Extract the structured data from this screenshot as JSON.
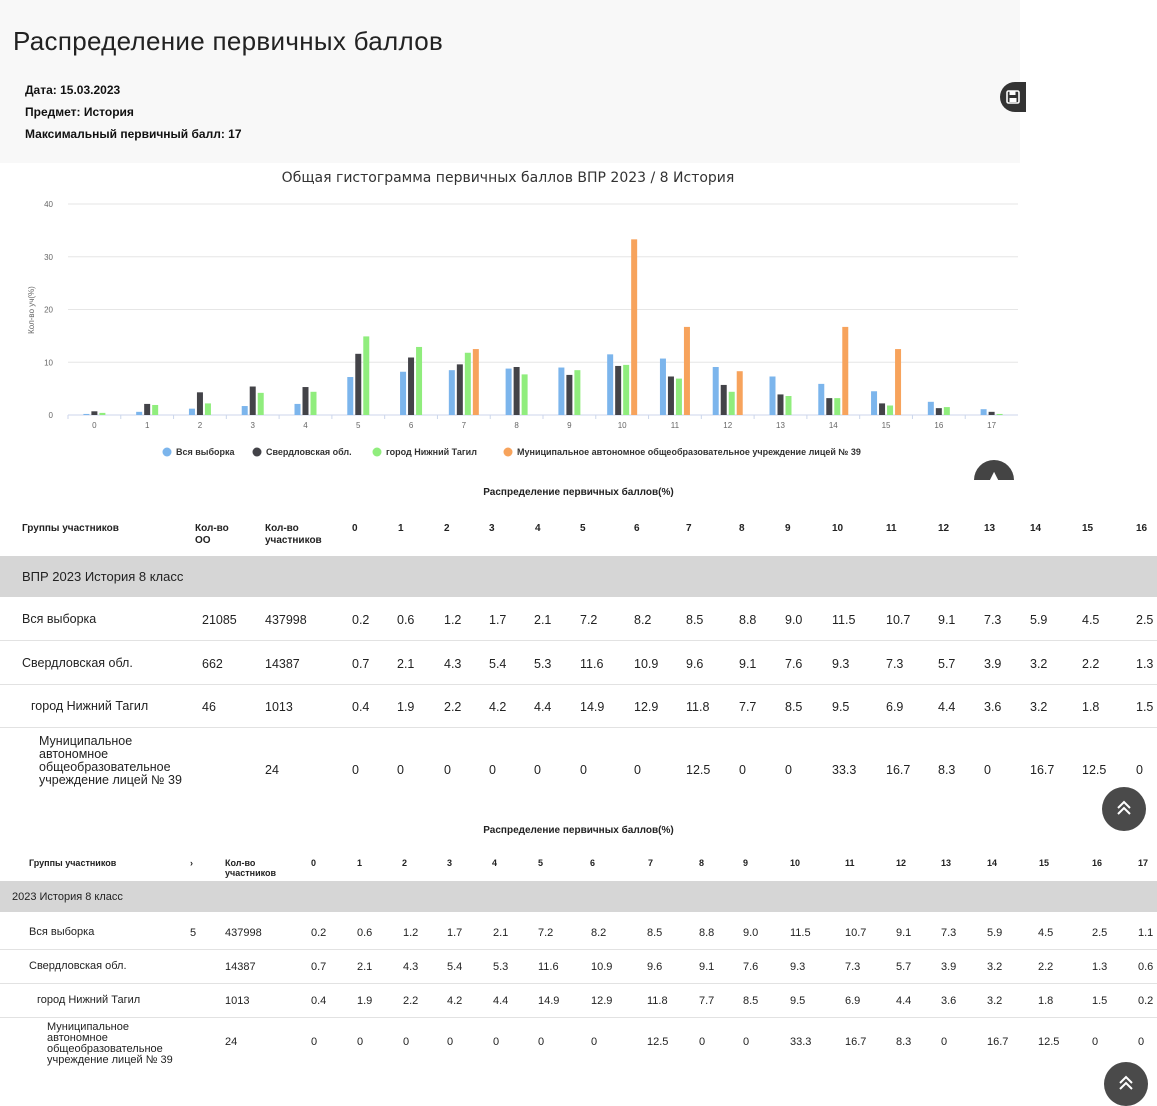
{
  "page": {
    "title": "Распределение первичных баллов",
    "meta": [
      "Дата: 15.03.2023",
      "Предмет: История",
      "Максимальный первичный балл: 17"
    ],
    "save_icon": "save-icon"
  },
  "chart_data": {
    "type": "bar",
    "title": "Общая гистограмма первичных баллов ВПР 2023 / 8 История",
    "ylabel": "Кол-во уч(%)",
    "xlabel": "",
    "ylim": [
      0,
      40
    ],
    "yticks": [
      "0",
      "10",
      "20",
      "30",
      "40"
    ],
    "grid": true,
    "legend_position": "bottom",
    "categories": [
      "0",
      "1",
      "2",
      "3",
      "4",
      "5",
      "6",
      "7",
      "8",
      "9",
      "10",
      "11",
      "12",
      "13",
      "14",
      "15",
      "16",
      "17"
    ],
    "series": [
      {
        "name": "Вся выборка",
        "color": "#7cb5ec",
        "values": [
          0.2,
          0.6,
          1.2,
          1.7,
          2.1,
          7.2,
          8.2,
          8.5,
          8.8,
          9.0,
          11.5,
          10.7,
          9.1,
          7.3,
          5.9,
          4.5,
          2.5,
          1.1
        ]
      },
      {
        "name": "Свердловская обл.",
        "color": "#434348",
        "values": [
          0.7,
          2.1,
          4.3,
          5.4,
          5.3,
          11.6,
          10.9,
          9.6,
          9.1,
          7.6,
          9.3,
          7.3,
          5.7,
          3.9,
          3.2,
          2.2,
          1.3,
          0.6
        ]
      },
      {
        "name": "город Нижний Тагил",
        "color": "#90ed7d",
        "values": [
          0.4,
          1.9,
          2.2,
          4.2,
          4.4,
          14.9,
          12.9,
          11.8,
          7.7,
          8.5,
          9.5,
          6.9,
          4.4,
          3.6,
          3.2,
          1.8,
          1.5,
          0.2
        ]
      },
      {
        "name": "Муниципальное автономное общеобразовательное учреждение лицей № 39",
        "color": "#f7a35c",
        "values": [
          0,
          0,
          0,
          0,
          0,
          0,
          0,
          12.5,
          0,
          0,
          33.3,
          16.7,
          8.3,
          0,
          16.7,
          12.5,
          0,
          0
        ]
      }
    ]
  },
  "table1": {
    "caption": "Распределение первичных баллов(%)",
    "headers": [
      "Группы участников",
      "Кол-во ОО",
      "Кол-во участников",
      "0",
      "1",
      "2",
      "3",
      "4",
      "5",
      "6",
      "7",
      "8",
      "9",
      "10",
      "11",
      "12",
      "13",
      "14",
      "15",
      "16"
    ],
    "section": "ВПР 2023 История 8 класс",
    "rows": [
      {
        "label": "Вся выборка",
        "oo": "21085",
        "count": "437998",
        "values": [
          "0.2",
          "0.6",
          "1.2",
          "1.7",
          "2.1",
          "7.2",
          "8.2",
          "8.5",
          "8.8",
          "9.0",
          "11.5",
          "10.7",
          "9.1",
          "7.3",
          "5.9",
          "4.5",
          "2.5"
        ]
      },
      {
        "label": "Свердловская обл.",
        "oo": "662",
        "count": "14387",
        "values": [
          "0.7",
          "2.1",
          "4.3",
          "5.4",
          "5.3",
          "11.6",
          "10.9",
          "9.6",
          "9.1",
          "7.6",
          "9.3",
          "7.3",
          "5.7",
          "3.9",
          "3.2",
          "2.2",
          "1.3"
        ]
      },
      {
        "label": "город Нижний Тагил",
        "oo": "46",
        "count": "1013",
        "values": [
          "0.4",
          "1.9",
          "2.2",
          "4.2",
          "4.4",
          "14.9",
          "12.9",
          "11.8",
          "7.7",
          "8.5",
          "9.5",
          "6.9",
          "4.4",
          "3.6",
          "3.2",
          "1.8",
          "1.5"
        ]
      },
      {
        "label": "Муниципальное автономное общеобразовательное учреждение лицей № 39",
        "oo": "",
        "count": "24",
        "values": [
          "0",
          "0",
          "0",
          "0",
          "0",
          "0",
          "0",
          "12.5",
          "0",
          "0",
          "33.3",
          "16.7",
          "8.3",
          "0",
          "16.7",
          "12.5",
          "0"
        ]
      }
    ]
  },
  "table2": {
    "caption": "Распределение первичных баллов(%)",
    "headers": [
      "Группы участников",
      "›",
      "Кол-во участников",
      "0",
      "1",
      "2",
      "3",
      "4",
      "5",
      "6",
      "7",
      "8",
      "9",
      "10",
      "11",
      "12",
      "13",
      "14",
      "15",
      "16",
      "17"
    ],
    "section": "2023 История 8 класс",
    "rows": [
      {
        "label": "Вся выборка",
        "oo": "5",
        "count": "437998",
        "values": [
          "0.2",
          "0.6",
          "1.2",
          "1.7",
          "2.1",
          "7.2",
          "8.2",
          "8.5",
          "8.8",
          "9.0",
          "11.5",
          "10.7",
          "9.1",
          "7.3",
          "5.9",
          "4.5",
          "2.5",
          "1.1"
        ]
      },
      {
        "label": "Свердловская обл.",
        "oo": "",
        "count": "14387",
        "values": [
          "0.7",
          "2.1",
          "4.3",
          "5.4",
          "5.3",
          "11.6",
          "10.9",
          "9.6",
          "9.1",
          "7.6",
          "9.3",
          "7.3",
          "5.7",
          "3.9",
          "3.2",
          "2.2",
          "1.3",
          "0.6"
        ]
      },
      {
        "label": "город Нижний Тагил",
        "oo": "",
        "count": "1013",
        "values": [
          "0.4",
          "1.9",
          "2.2",
          "4.2",
          "4.4",
          "14.9",
          "12.9",
          "11.8",
          "7.7",
          "8.5",
          "9.5",
          "6.9",
          "4.4",
          "3.6",
          "3.2",
          "1.8",
          "1.5",
          "0.2"
        ]
      },
      {
        "label": "Муниципальное автономное общеобразовательное учреждение лицей № 39",
        "oo": "",
        "count": "24",
        "values": [
          "0",
          "0",
          "0",
          "0",
          "0",
          "0",
          "0",
          "12.5",
          "0",
          "0",
          "33.3",
          "16.7",
          "8.3",
          "0",
          "16.7",
          "12.5",
          "0",
          "0"
        ]
      }
    ]
  },
  "scroll_top_icon": "chevrons-up-icon"
}
